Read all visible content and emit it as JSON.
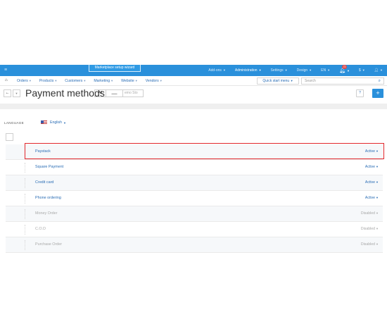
{
  "topbar": {
    "wizard_label": "Marketplace setup wizard",
    "items": [
      {
        "label": "Add-ons",
        "active": false
      },
      {
        "label": "Administration",
        "active": true
      },
      {
        "label": "Settings",
        "active": false
      },
      {
        "label": "Design",
        "active": false
      },
      {
        "label": "EN",
        "active": false
      }
    ],
    "notifications_count": "72",
    "currency": "$"
  },
  "navbar": {
    "links": [
      "Orders",
      "Products",
      "Customers",
      "Marketing",
      "Website",
      "Vendors"
    ],
    "quick_start": "Quick start menu",
    "search_placeholder": "Search"
  },
  "title_row": {
    "title": "Payment methods",
    "store_all": "All",
    "store_demo": "emo Sto"
  },
  "language": {
    "label": "LANGUAGE",
    "selected": "English"
  },
  "payment_methods": [
    {
      "name": "Paystack",
      "status": "Active",
      "disabled": false,
      "highlighted": true
    },
    {
      "name": "Square Payment",
      "status": "Active",
      "disabled": false,
      "highlighted": false
    },
    {
      "name": "Credit card",
      "status": "Active",
      "disabled": false,
      "highlighted": false
    },
    {
      "name": "Phone ordering",
      "status": "Active",
      "disabled": false,
      "highlighted": false
    },
    {
      "name": "Money Order",
      "status": "Disabled",
      "disabled": true,
      "highlighted": false
    },
    {
      "name": "C.O.D",
      "status": "Disabled",
      "disabled": true,
      "highlighted": false
    },
    {
      "name": "Purchase Order",
      "status": "Disabled",
      "disabled": true,
      "highlighted": false
    }
  ]
}
